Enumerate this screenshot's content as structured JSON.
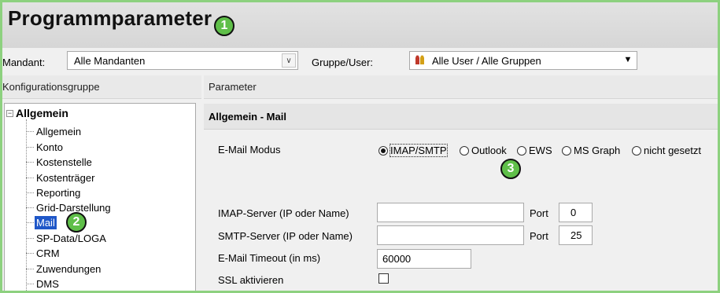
{
  "window": {
    "title": "Programmparameter"
  },
  "callouts": {
    "one": "1",
    "two": "2",
    "three": "3"
  },
  "filter": {
    "mandant_label": "Mandant:",
    "mandant_value": "Alle Mandanten",
    "gruppe_label": "Gruppe/User:",
    "gruppe_value": "Alle User / Alle Gruppen"
  },
  "left_panel": {
    "header": "Konfigurationsgruppe",
    "root": "Allgemein",
    "items": [
      {
        "label": "Allgemein",
        "selected": false
      },
      {
        "label": "Konto",
        "selected": false
      },
      {
        "label": "Kostenstelle",
        "selected": false
      },
      {
        "label": "Kostenträger",
        "selected": false
      },
      {
        "label": "Reporting",
        "selected": false
      },
      {
        "label": "Grid-Darstellung",
        "selected": false
      },
      {
        "label": "Mail",
        "selected": true
      },
      {
        "label": "SP-Data/LOGA",
        "selected": false
      },
      {
        "label": "CRM",
        "selected": false
      },
      {
        "label": "Zuwendungen",
        "selected": false
      },
      {
        "label": "DMS",
        "selected": false
      }
    ]
  },
  "right_panel": {
    "header": "Parameter",
    "section_title": "Allgemein - Mail",
    "mail_mode": {
      "label": "E-Mail Modus",
      "options": [
        "IMAP/SMTP",
        "Outlook",
        "EWS",
        "MS Graph",
        "nicht gesetzt"
      ],
      "selected": "IMAP/SMTP"
    },
    "imap": {
      "label": "IMAP-Server (IP oder Name)",
      "value": "",
      "port_label": "Port",
      "port": "0"
    },
    "smtp": {
      "label": "SMTP-Server (IP oder Name)",
      "value": "",
      "port_label": "Port",
      "port": "25"
    },
    "timeout": {
      "label": "E-Mail Timeout (in ms)",
      "value": "60000"
    },
    "ssl": {
      "label": "SSL aktivieren",
      "checked": false
    }
  },
  "colors": {
    "frame_border": "#8dd17f",
    "callout_fill": "#5fbf49",
    "selection": "#1f57c8"
  }
}
